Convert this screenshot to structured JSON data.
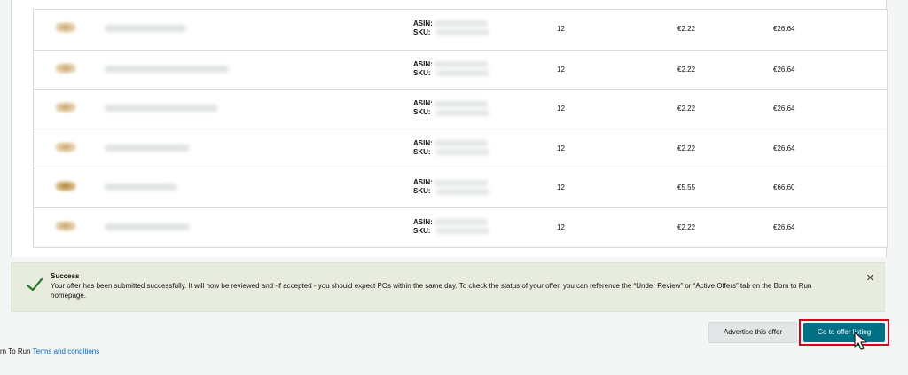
{
  "table": {
    "rows": [
      {
        "asin_label": "ASIN:",
        "sku_label": "SKU:",
        "quantity": "12",
        "unit_price": "€2.22",
        "total": "€26.64"
      },
      {
        "asin_label": "ASIN:",
        "sku_label": "SKU:",
        "quantity": "12",
        "unit_price": "€2.22",
        "total": "€26.64"
      },
      {
        "asin_label": "ASIN:",
        "sku_label": "SKU:",
        "quantity": "12",
        "unit_price": "€2.22",
        "total": "€26.64"
      },
      {
        "asin_label": "ASIN:",
        "sku_label": "SKU:",
        "quantity": "12",
        "unit_price": "€2.22",
        "total": "€26.64"
      },
      {
        "asin_label": "ASIN:",
        "sku_label": "SKU:",
        "quantity": "12",
        "unit_price": "€5.55",
        "total": "€66.60"
      },
      {
        "asin_label": "ASIN:",
        "sku_label": "SKU:",
        "quantity": "12",
        "unit_price": "€2.22",
        "total": "€26.64"
      }
    ]
  },
  "alert": {
    "title": "Success",
    "message": "Your offer has been submitted successfully. It will now be reviewed and -if accepted - you should expect POs within the same day. To check the status of your offer, you can reference the “Under Review” or “Active Offers” tab on the Born to Run homepage.",
    "close_glyph": "✕",
    "icon": "check-icon",
    "color": "#e8ecdf"
  },
  "actions": {
    "advertise_label": "Advertise this offer",
    "go_label": "Go to offer listing",
    "primary_color": "#007185",
    "highlight_color": "#d6001c"
  },
  "footer": {
    "prefix": "rn To Run",
    "link": "Terms and conditions"
  }
}
